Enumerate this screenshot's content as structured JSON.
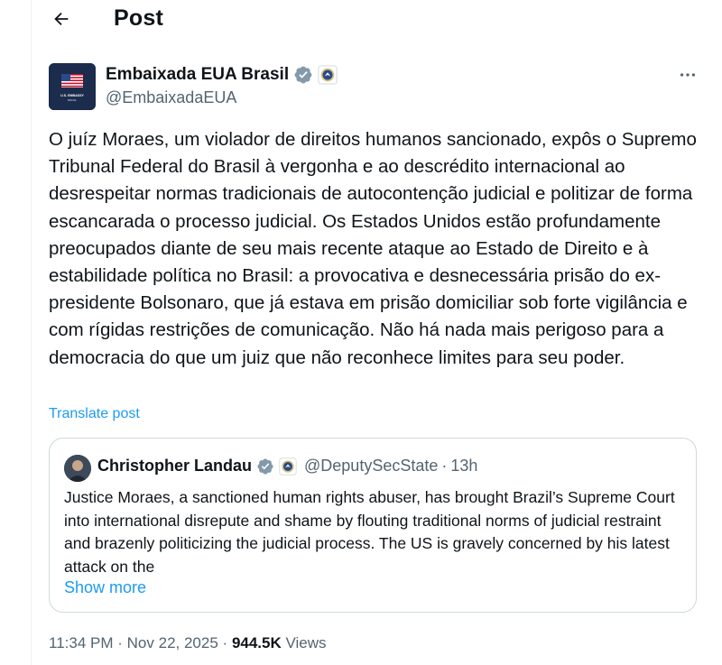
{
  "header": {
    "title": "Post",
    "back_icon": "arrow-left-icon"
  },
  "author": {
    "name": "Embaixada EUA Brasil",
    "handle": "@EmbaixadaEUA",
    "avatar_caption": "U.S. EMBASSY",
    "avatar_subcaption": "BRASIL",
    "verified_icon": "verified-badge-icon",
    "affiliate_icon": "state-department-seal-icon",
    "verified_color": "#829aab"
  },
  "more_icon": "more-options-icon",
  "post": {
    "text": "O juíz Moraes, um violador de direitos humanos sancionado, expôs o Supremo Tribunal Federal do Brasil à vergonha e ao descrédito internacional ao desrespeitar normas tradicionais de autocontenção judicial e politizar de forma escancarada o processo judicial. Os Estados Unidos estão profundamente preocupados diante de seu mais recente ataque ao Estado de Direito e à estabilidade política no Brasil: a provocativa e desnecessária prisão do ex-presidente Bolsonaro, que já estava em prisão domiciliar sob forte vigilância e com rígidas restrições de comunicação. Não há nada mais perigoso para a democracia do que um juiz que não reconhece limites para seu poder.",
    "translate_label": "Translate post"
  },
  "quote": {
    "name": "Christopher Landau",
    "handle": "@DeputySecState",
    "separator": "·",
    "time": "13h",
    "text": "Justice Moraes, a sanctioned human rights abuser, has brought Brazil’s Supreme Court into international disrepute and shame by flouting traditional norms of judicial restraint and brazenly politicizing the judicial process. The US is gravely concerned by his latest attack on the",
    "show_more_label": "Show more"
  },
  "meta": {
    "time": "11:34 PM",
    "dot1": "·",
    "date": "Nov 22, 2025",
    "dot2": "·",
    "views_count": "944.5K",
    "views_label": "Views"
  },
  "colors": {
    "link": "#1d9bf0",
    "secondary_text": "#536471",
    "border": "#cfd9de"
  }
}
